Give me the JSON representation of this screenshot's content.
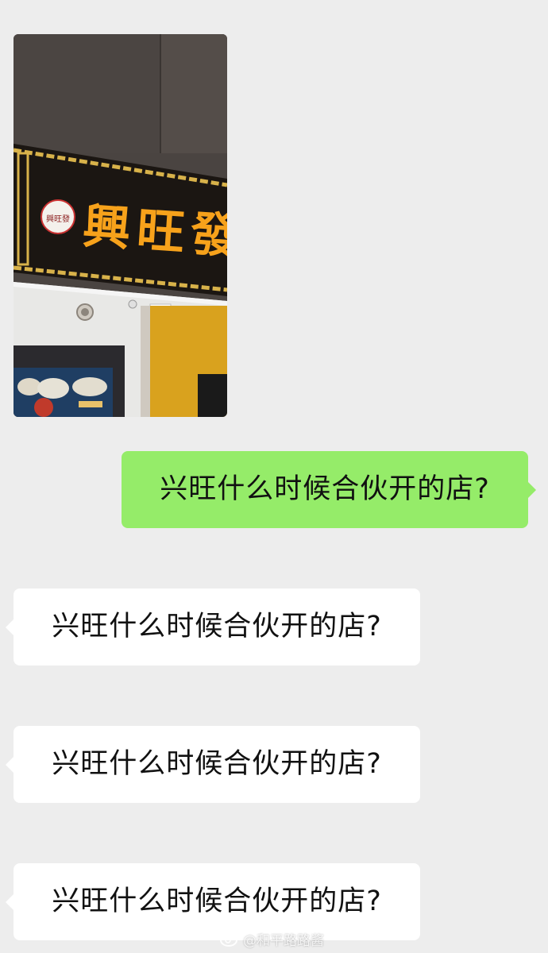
{
  "chat": {
    "image_message": {
      "sign_text": "興旺發",
      "logo_text": "興旺發",
      "photo_colors": {
        "wall": "#4a4441",
        "sign_bg": "#1b1612",
        "sign_text": "#f7a21b",
        "gold_border": "#d8b24a",
        "storefront": "#e8e8e6",
        "yellow_wall": "#d9a21e"
      }
    },
    "outgoing": {
      "text": "兴旺什么时候合伙开的店?"
    },
    "incoming": [
      {
        "text": "兴旺什么时候合伙开的店?"
      },
      {
        "text": "兴旺什么时候合伙开的店?"
      },
      {
        "text": "兴旺什么时候合伙开的店?"
      }
    ]
  },
  "watermark": {
    "text": "@和平路路酱",
    "icon": "weibo-icon"
  },
  "colors": {
    "background": "#ededed",
    "outgoing_bubble": "#95ec69",
    "incoming_bubble": "#ffffff"
  }
}
